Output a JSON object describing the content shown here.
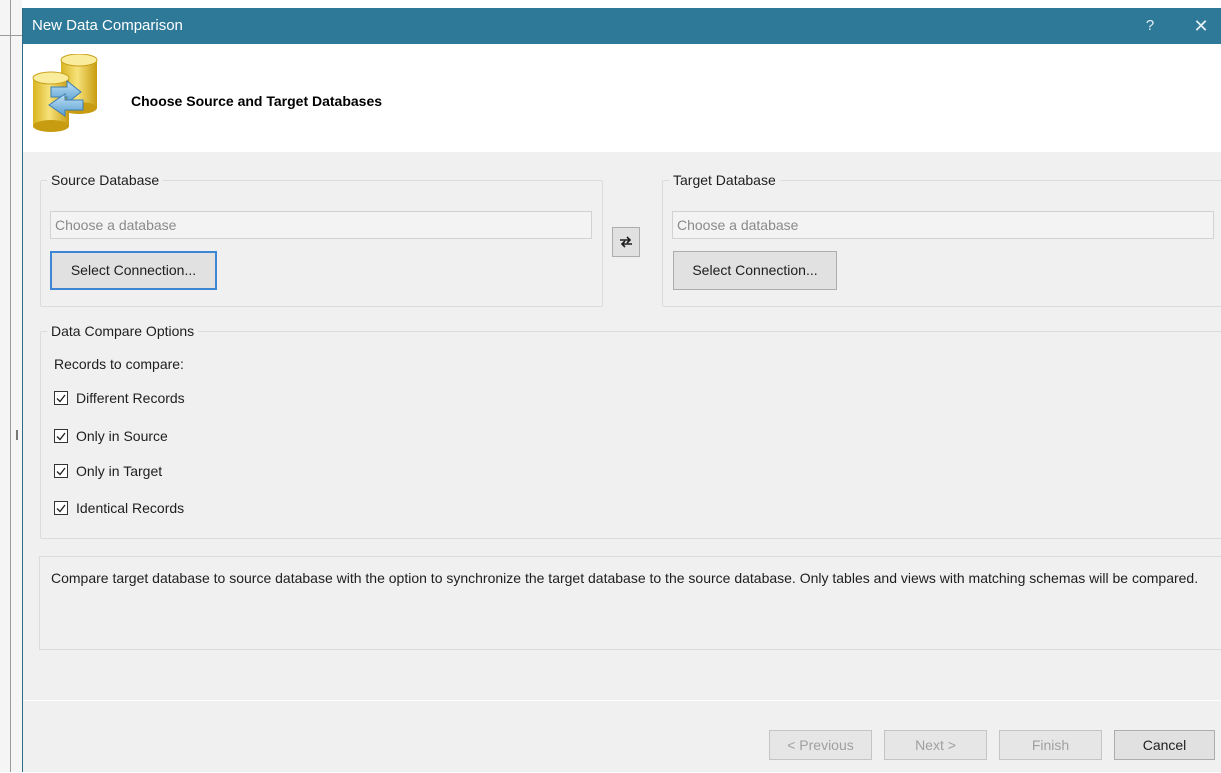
{
  "window": {
    "title": "New Data Comparison",
    "help_label": "?",
    "close_label": "✕"
  },
  "header": {
    "title": "Choose Source and Target Databases",
    "icon": "database-compare-icon"
  },
  "source": {
    "group_label": "Source Database",
    "placeholder": "Choose a database",
    "value": "",
    "select_button": "Select Connection..."
  },
  "target": {
    "group_label": "Target Database",
    "placeholder": "Choose a database",
    "value": "",
    "select_button": "Select Connection..."
  },
  "swap": {
    "icon": "swap-arrows-icon"
  },
  "options": {
    "group_label": "Data Compare Options",
    "records_label": "Records to compare:",
    "checkboxes": [
      {
        "label": "Different Records",
        "checked": true
      },
      {
        "label": "Only in Source",
        "checked": true
      },
      {
        "label": "Only in Target",
        "checked": true
      },
      {
        "label": "Identical Records",
        "checked": true
      }
    ]
  },
  "description": "Compare target database to source database with the option to synchronize the target database to the source database. Only tables and views with matching schemas will be compared.",
  "footer": {
    "previous": "< Previous",
    "next": "Next >",
    "finish": "Finish",
    "cancel": "Cancel"
  },
  "colors": {
    "titlebar": "#2e7998",
    "dialog_bg": "#f0f0f0",
    "focus_border": "#3c86d4"
  }
}
